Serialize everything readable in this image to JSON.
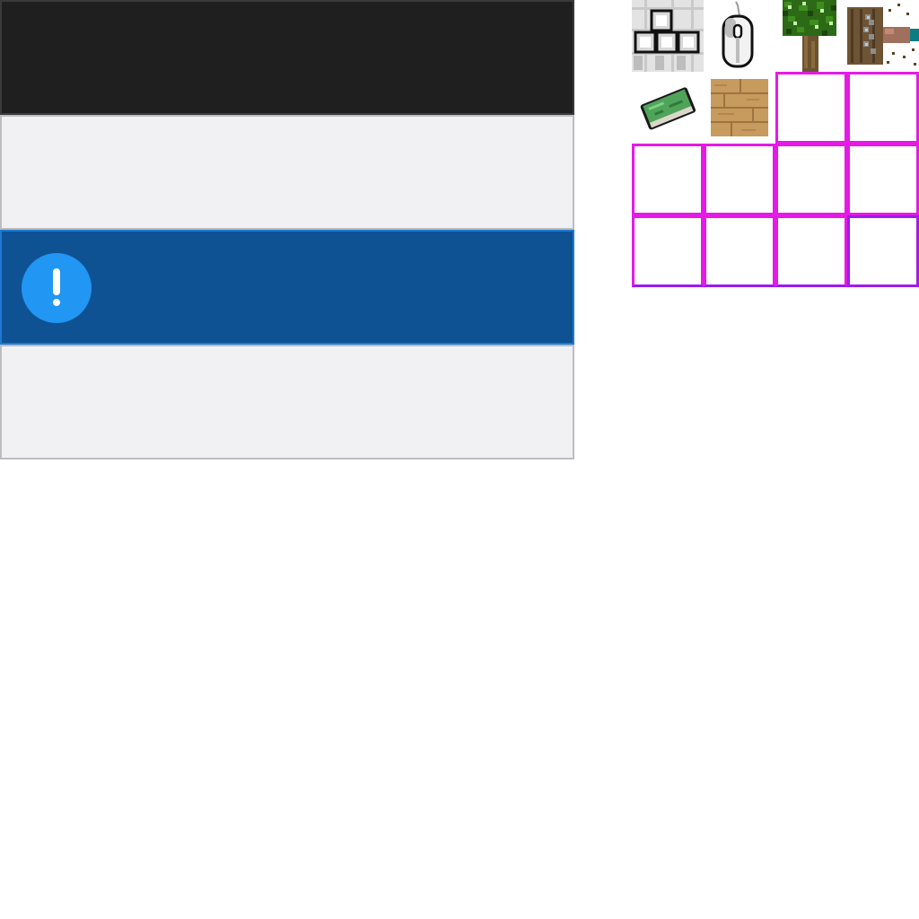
{
  "panels": [
    {
      "id": "dark",
      "style": "dark"
    },
    {
      "id": "light-1",
      "style": "light"
    },
    {
      "id": "info",
      "style": "info",
      "icon": "exclamation-circle-icon"
    },
    {
      "id": "light-2",
      "style": "light"
    }
  ],
  "sprites": [
    {
      "icon": "keyboard-keys-icon"
    },
    {
      "icon": "mouse-icon"
    },
    {
      "icon": "oak-tree-icon"
    },
    {
      "icon": "pickaxe-log-icon"
    },
    {
      "icon": "green-book-icon"
    },
    {
      "icon": "oak-planks-icon"
    }
  ],
  "empty_slots": 10,
  "colors": {
    "dark_panel": "#1f1f1f",
    "light_panel": "#f1f1f3",
    "info_panel": "#0e5294",
    "info_icon": "#2196f3",
    "slot_border_magenta": "#e619e6",
    "slot_border_violet": "#a01aeb"
  }
}
